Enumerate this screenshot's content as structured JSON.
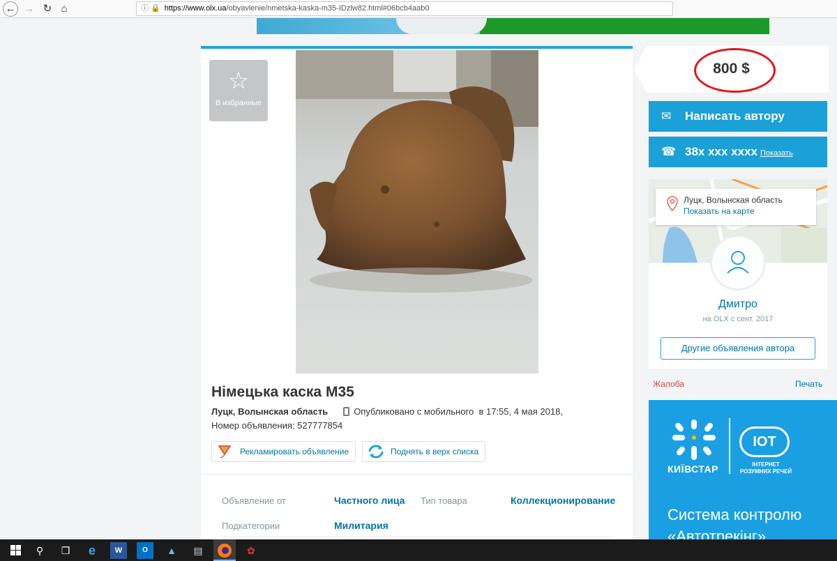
{
  "browser": {
    "url_host": "https://www.olx.ua",
    "url_path": "/obyavlenie/nmetska-kaska-m35-IDzlw82.html#06bcb4aab0",
    "back_icon": "arrow-left-icon",
    "forward_icon": "arrow-right-icon",
    "reload_icon": "reload-icon",
    "home_icon": "home-icon"
  },
  "listing": {
    "favorite_label": "В избранные",
    "title": "Німецька каска М35",
    "city": "Луцк, Волынская область",
    "published": "Опубликовано с мобильного",
    "published_time": "в 17:55, 4 мая 2018,",
    "ad_number": "Номер объявления: 527777854",
    "promote_label": "Рекламировать объявление",
    "raise_label": "Поднять в верх списка"
  },
  "params": {
    "from_label": "Объявление от",
    "from_value": "Частного лица",
    "type_label": "Тип товара",
    "type_value": "Коллекционирование",
    "subcat_label": "Подкатегории",
    "subcat_value": "Милитария"
  },
  "sidebar": {
    "price": "800 $",
    "message_label": "Написать автору",
    "phone": "38x xxx xxxx",
    "show_label": "Показать",
    "location_city": "Луцк, Волынская область",
    "show_on_map": "Показать на карте",
    "seller_name": "Дмитро",
    "seller_since": "на OLX с сент. 2017",
    "other_ads": "Другие объявления автора",
    "complaint": "Жалоба",
    "print": "Печать"
  },
  "side_ad": {
    "brand": "КИЇВСТАР",
    "iot": "IOT",
    "iot_sub": "ІНТЕРНЕТ РОЗУМНИХ РЕЧЕЙ",
    "line1": "Система контролю",
    "line2": "«Автотрекінг»"
  },
  "colors": {
    "accent": "#1ba0d7",
    "link": "#0074a6",
    "price_circle": "#e0161b",
    "complaint": "#d54242"
  }
}
